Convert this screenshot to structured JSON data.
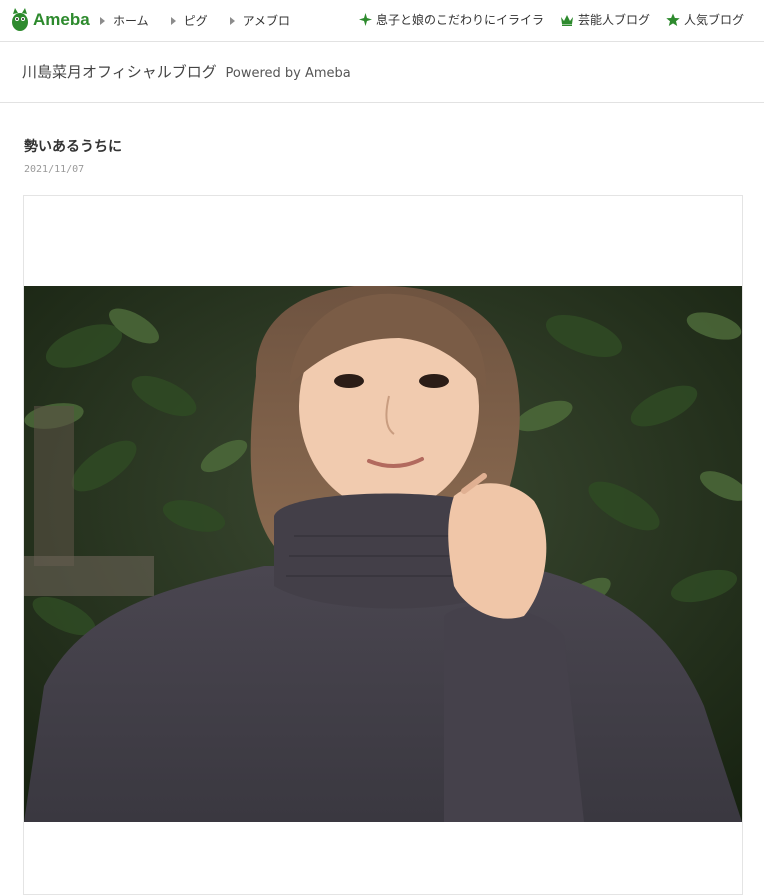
{
  "header": {
    "logo": {
      "icon": "ameba-mascot-icon",
      "text": "Ameba",
      "color": "#2d8a2d"
    },
    "nav": [
      {
        "label": "ホーム"
      },
      {
        "label": "ピグ"
      },
      {
        "label": "アメブロ"
      }
    ],
    "right_links": [
      {
        "icon": "sparkle-icon",
        "label": "息子と娘のこだわりにイライラ",
        "color": "#2d8a2d"
      },
      {
        "icon": "crown-icon",
        "label": "芸能人ブログ",
        "color": "#2d8a2d"
      },
      {
        "icon": "star-icon",
        "label": "人気ブログ",
        "color": "#2d8a2d"
      }
    ]
  },
  "blog": {
    "title": "川島菜月オフィシャルブログ",
    "powered": "Powered by Ameba"
  },
  "entry": {
    "title": "勢いあるうちに",
    "date": "2021/11/07",
    "photo": {
      "description_icon": "photo-image"
    }
  }
}
